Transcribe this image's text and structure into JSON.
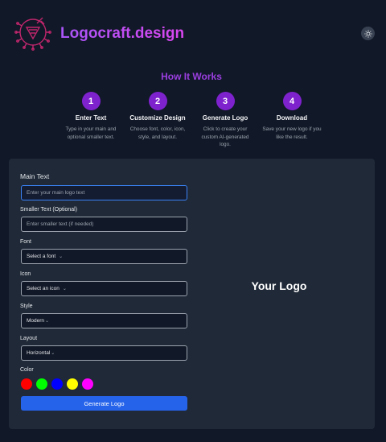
{
  "header": {
    "brand": "Logocraft.design",
    "logo_icon": "circuit-pen-icon",
    "theme_icon": "sun-icon"
  },
  "how_it_works": {
    "title": "How It Works",
    "steps": [
      {
        "number": "1",
        "title": "Enter Text",
        "desc": "Type in your main and optional smaller text."
      },
      {
        "number": "2",
        "title": "Customize Design",
        "desc": "Choose font, color, icon, style, and layout."
      },
      {
        "number": "3",
        "title": "Generate Logo",
        "desc": "Click to create your custom AI-generated logo."
      },
      {
        "number": "4",
        "title": "Download",
        "desc": "Save your new logo if you like the result."
      }
    ]
  },
  "form": {
    "main_text_label": "Main Text",
    "main_text_placeholder": "Enter your main logo text",
    "smaller_text_label": "Smaller Text (Optional)",
    "smaller_text_placeholder": "Enter smaller text (if needed)",
    "font_label": "Font",
    "font_value": "Select a font",
    "icon_label": "Icon",
    "icon_value": "Select an icon",
    "style_label": "Style",
    "style_value": "Modern",
    "layout_label": "Layout",
    "layout_value": "Horizontal",
    "color_label": "Color",
    "colors": [
      "#ff0000",
      "#00ff00",
      "#0000ff",
      "#ffff00",
      "#ff00ff"
    ],
    "generate_label": "Generate Logo"
  },
  "preview": {
    "text": "Your Logo"
  },
  "accent": "#7e22ce",
  "button_color": "#2563eb"
}
